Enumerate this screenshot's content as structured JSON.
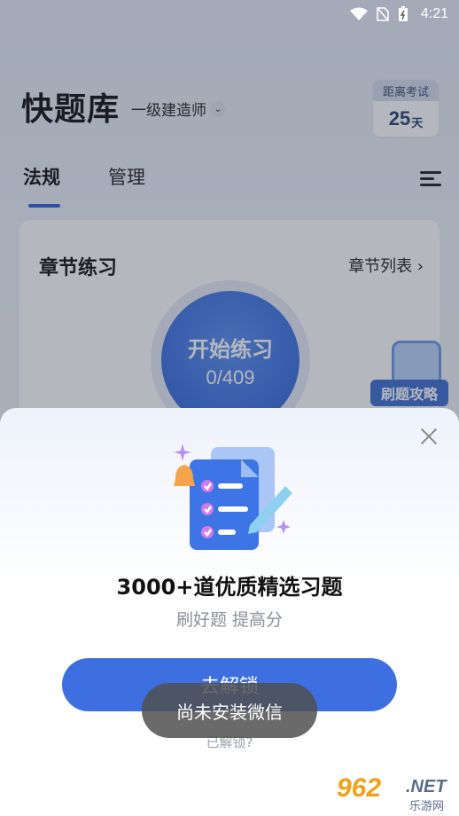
{
  "status_bar": {
    "time": "4:21"
  },
  "header": {
    "app_title": "快题库",
    "exam_selector": "一级建造师",
    "countdown": {
      "label": "距离考试",
      "value": "25",
      "unit": "天"
    }
  },
  "tabs": [
    {
      "label": "法规",
      "active": true
    },
    {
      "label": "管理",
      "active": false
    }
  ],
  "chapter_card": {
    "title": "章节练习",
    "link": "章节列表 ›",
    "practice_button": {
      "label": "开始练习",
      "progress": "0/409"
    },
    "strategy_badge": "刷题攻略"
  },
  "sheet": {
    "title": "3000+道优质精选习题",
    "subtitle": "刷好题  提高分",
    "primary_button": "去解锁",
    "secondary_link": "已解锁?"
  },
  "toast": "尚未安装微信",
  "watermark": {
    "number": "962",
    "domain": ".NET",
    "site": "乐游网"
  },
  "colors": {
    "primary": "#3d6fe0",
    "accent_tab": "#2e62d6"
  }
}
